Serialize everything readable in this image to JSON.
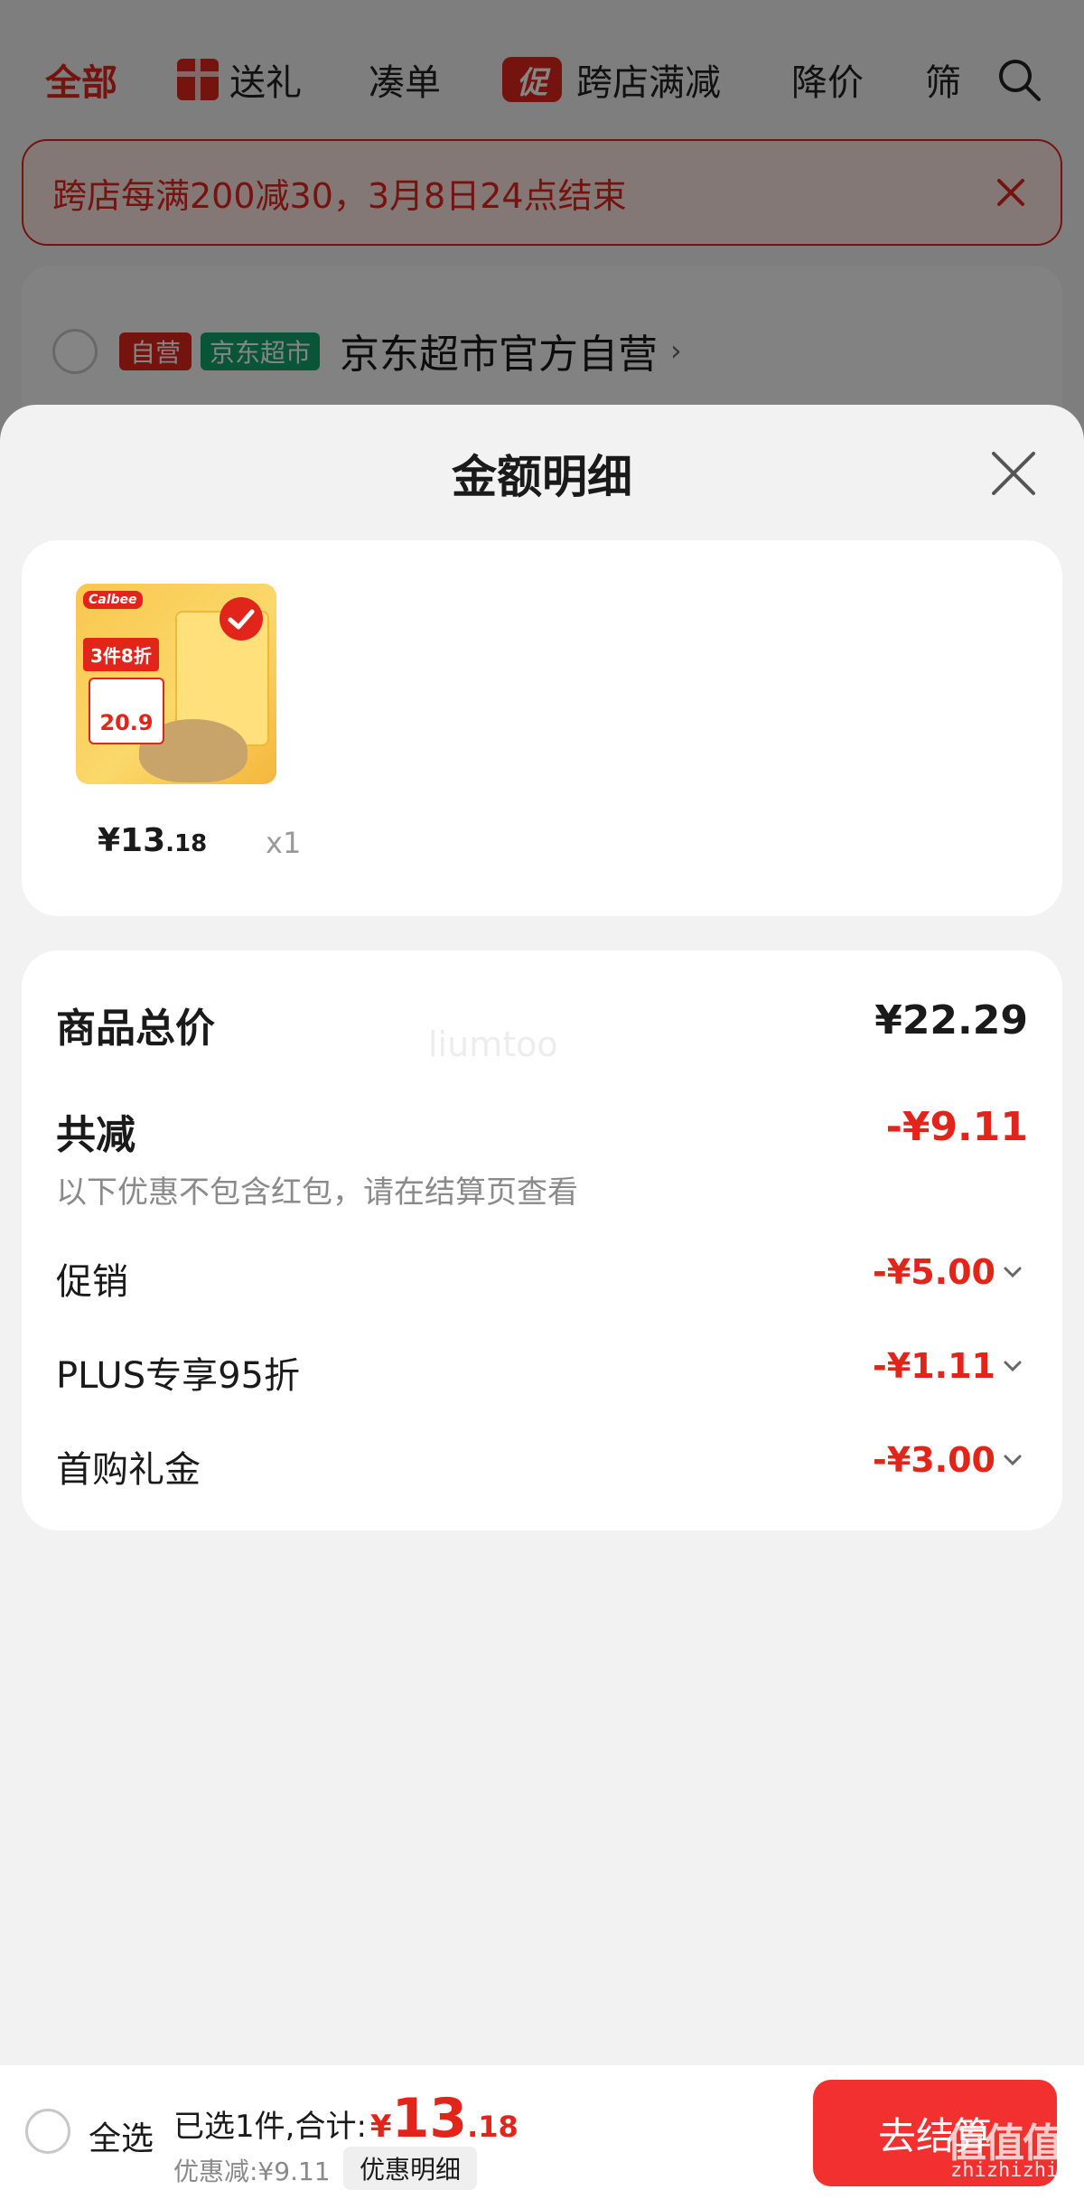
{
  "top_tabs": {
    "all": "全部",
    "gift": "送礼",
    "bundle": "凑单",
    "promo_badge": "促",
    "cross_store": "跨店满减",
    "price_drop": "降价",
    "filter": "筛"
  },
  "promo_banner": {
    "text": "跨店每满200减30，3月8日24点结束"
  },
  "store": {
    "tag_self": "自营",
    "tag_market": "京东超市",
    "name": "京东超市官方自营",
    "chevron": "›"
  },
  "sheet": {
    "title": "金额明细"
  },
  "product": {
    "thumb_brand": "Calbee",
    "thumb_label": "3件8折",
    "thumb_price": "20.9",
    "price_main": "¥13",
    "price_cents": ".18",
    "qty": "x1"
  },
  "summary": {
    "total_label": "商品总价",
    "total_value": "¥22.29",
    "watermark": "liumtoo",
    "reduce_label": "共减",
    "reduce_value": "-¥9.11",
    "note": "以下优惠不包含红包，请在结算页查看",
    "items": [
      {
        "label": "促销",
        "value": "-¥5.00"
      },
      {
        "label": "PLUS专享95折",
        "value": "-¥1.11"
      },
      {
        "label": "首购礼金",
        "value": "-¥3.00"
      }
    ]
  },
  "bottom_bar": {
    "select_all": "全选",
    "selected_prefix": "已选1件,合计:",
    "yen": "¥",
    "amount": "13",
    "amount_cents": ".18",
    "discount": "优惠减:¥9.11",
    "detail_button": "优惠明细",
    "checkout": "去结算"
  },
  "corner_watermark": {
    "logo": "值值值",
    "url": "zhizhizhi.com"
  },
  "colors": {
    "accent": "#e1251b",
    "checkout": "#f23030",
    "market_green": "#10a66a"
  }
}
